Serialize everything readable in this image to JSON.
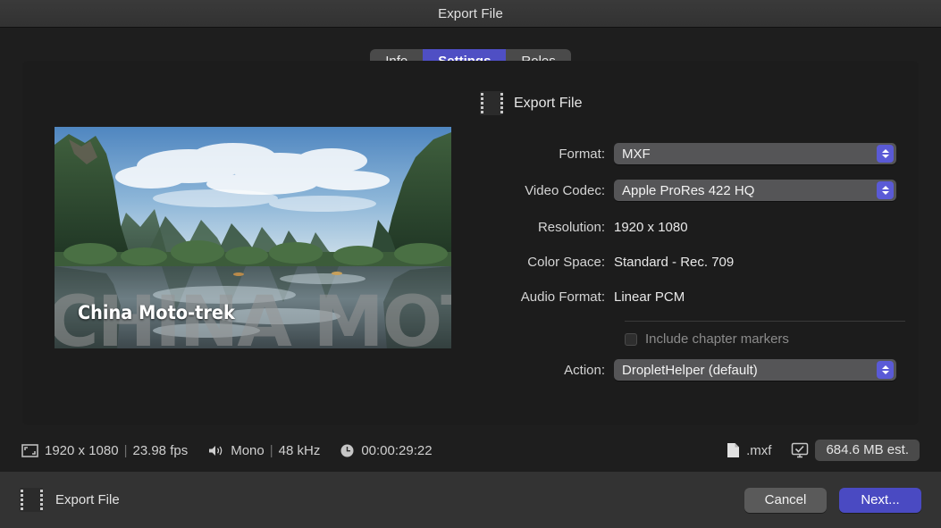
{
  "window": {
    "title": "Export File"
  },
  "tabs": [
    {
      "label": "Info",
      "active": false
    },
    {
      "label": "Settings",
      "active": true
    },
    {
      "label": "Roles",
      "active": false
    }
  ],
  "preview": {
    "overlay_text": "CHINA MOTO-TREK",
    "title_text": "China Moto-trek"
  },
  "form": {
    "header_label": "Export File",
    "header_icon": "film-strip-icon",
    "format": {
      "label": "Format:",
      "value": "MXF"
    },
    "video_codec": {
      "label": "Video Codec:",
      "value": "Apple ProRes 422 HQ"
    },
    "resolution": {
      "label": "Resolution:",
      "value": "1920 x 1080"
    },
    "color_space": {
      "label": "Color Space:",
      "value": "Standard - Rec. 709"
    },
    "audio_format": {
      "label": "Audio Format:",
      "value": "Linear PCM"
    },
    "include_chapter_markers": {
      "label": "Include chapter markers",
      "checked": false
    },
    "action": {
      "label": "Action:",
      "value": "DropletHelper (default)"
    }
  },
  "status": {
    "resolution_icon": "frame-icon",
    "resolution": "1920 x 1080",
    "separator": "|",
    "fps": "23.98 fps",
    "audio_icon": "speaker-icon",
    "audio_channels": "Mono",
    "sample_rate": "48 kHz",
    "clock_icon": "clock-icon",
    "duration": "00:00:29:22",
    "file_icon": "document-icon",
    "extension": ".mxf",
    "destination_icon": "display-check-icon",
    "estimated_size": "684.6 MB est."
  },
  "footer": {
    "icon": "film-strip-icon",
    "label": "Export File",
    "cancel_label": "Cancel",
    "next_label": "Next..."
  },
  "colors": {
    "accent": "#4f4fc4",
    "popup_chevron": "#5a5ad6",
    "window_bg": "#1e1e1e",
    "panel_bg": "#1c1c1c",
    "footer_bg": "#333333"
  }
}
